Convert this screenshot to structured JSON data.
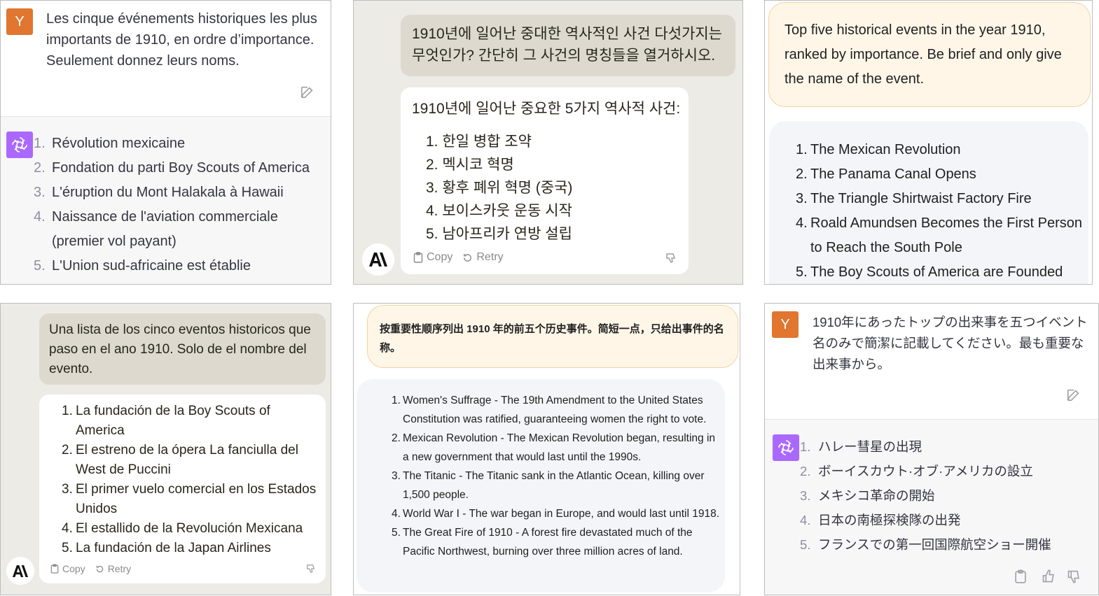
{
  "panel_fr": {
    "avatar_letter": "Y",
    "prompt": "Les cinque événements historiques les plus importants de 1910, en ordre d’importance. Seulement donnez leurs noms.",
    "items": [
      {
        "n": "1.",
        "text": "Révolution mexicaine"
      },
      {
        "n": "2.",
        "text": "Fondation du parti Boy Scouts of America"
      },
      {
        "n": "3.",
        "text": "L'éruption du Mont Halakala à Hawaii"
      },
      {
        "n": "4.",
        "text": "Naissance de l'aviation commerciale (premier vol payant)"
      },
      {
        "n": "5.",
        "text": "L'Union sud-africaine est établie"
      }
    ]
  },
  "panel_ko": {
    "prompt": "1910년에 일어난 중대한 역사적인 사건 다섯가지는 무엇인가? 간단히 그 사건의 명칭들을 열거하시오.",
    "reply_intro": "1910년에 일어난 중요한 5가지 역사적 사건:",
    "items": [
      {
        "n": "1.",
        "text": "한일 병합 조약"
      },
      {
        "n": "2.",
        "text": "멕시코 혁명"
      },
      {
        "n": "3.",
        "text": "황후 폐위 혁명 (중국)"
      },
      {
        "n": "4.",
        "text": "보이스카웃 운동 시작"
      },
      {
        "n": "5.",
        "text": "남아프리카 연방 설립"
      }
    ],
    "copy_label": "Copy",
    "retry_label": "Retry"
  },
  "panel_en": {
    "prompt": "Top five historical events in the year 1910, ranked by importance. Be brief and only give the name of the event.",
    "items": [
      {
        "n": "1.",
        "text": "The Mexican Revolution"
      },
      {
        "n": "2.",
        "text": "The Panama Canal Opens"
      },
      {
        "n": "3.",
        "text": "The Triangle Shirtwaist Factory Fire"
      },
      {
        "n": "4.",
        "text": "Roald Amundsen Becomes the First Person to Reach the South Pole"
      },
      {
        "n": "5.",
        "text": "The Boy Scouts of America are Founded"
      }
    ]
  },
  "panel_es": {
    "prompt": "Una lista de los cinco eventos historicos que paso en el ano 1910. Solo de el nombre del evento.",
    "items": [
      {
        "n": "1.",
        "text": "La fundación de la Boy Scouts of America"
      },
      {
        "n": "2.",
        "text": "El estreno de la ópera La fanciulla del West de Puccini"
      },
      {
        "n": "3.",
        "text": "El primer vuelo comercial en los Estados Unidos"
      },
      {
        "n": "4.",
        "text": "El estallido de la Revolución Mexicana"
      },
      {
        "n": "5.",
        "text": "La fundación de la Japan Airlines"
      }
    ],
    "copy_label": "Copy",
    "retry_label": "Retry"
  },
  "panel_zh": {
    "prompt": "按重要性顺序列出 1910 年的前五个历史事件。简短一点，只给出事件的名称。",
    "items": [
      {
        "n": "1.",
        "text": "Women's Suffrage - The 19th Amendment to the United States Constitution was ratified, guaranteeing women the right to vote."
      },
      {
        "n": "2.",
        "text": "Mexican Revolution - The Mexican Revolution began, resulting in a new government that would last until the 1990s."
      },
      {
        "n": "3.",
        "text": "The Titanic - The Titanic sank in the Atlantic Ocean, killing over 1,500 people."
      },
      {
        "n": "4.",
        "text": "World War I - The war began in Europe, and would last until 1918."
      },
      {
        "n": "5.",
        "text": "The Great Fire of 1910 - A forest fire devastated much of the Pacific Northwest, burning over three million acres of land."
      }
    ]
  },
  "panel_ja": {
    "avatar_letter": "Y",
    "prompt": "1910年にあったトップの出来事を五つイベント名のみで簡潔に記載してください。最も重要な出来事から。",
    "items": [
      {
        "n": "1.",
        "text": "ハレー彗星の出現"
      },
      {
        "n": "2.",
        "text": "ボーイスカウト·オブ·アメリカの設立"
      },
      {
        "n": "3.",
        "text": "メキシコ革命の開始"
      },
      {
        "n": "4.",
        "text": "日本の南極探検隊の出発"
      },
      {
        "n": "5.",
        "text": "フランスでの第一回国際航空ショー開催"
      }
    ]
  }
}
